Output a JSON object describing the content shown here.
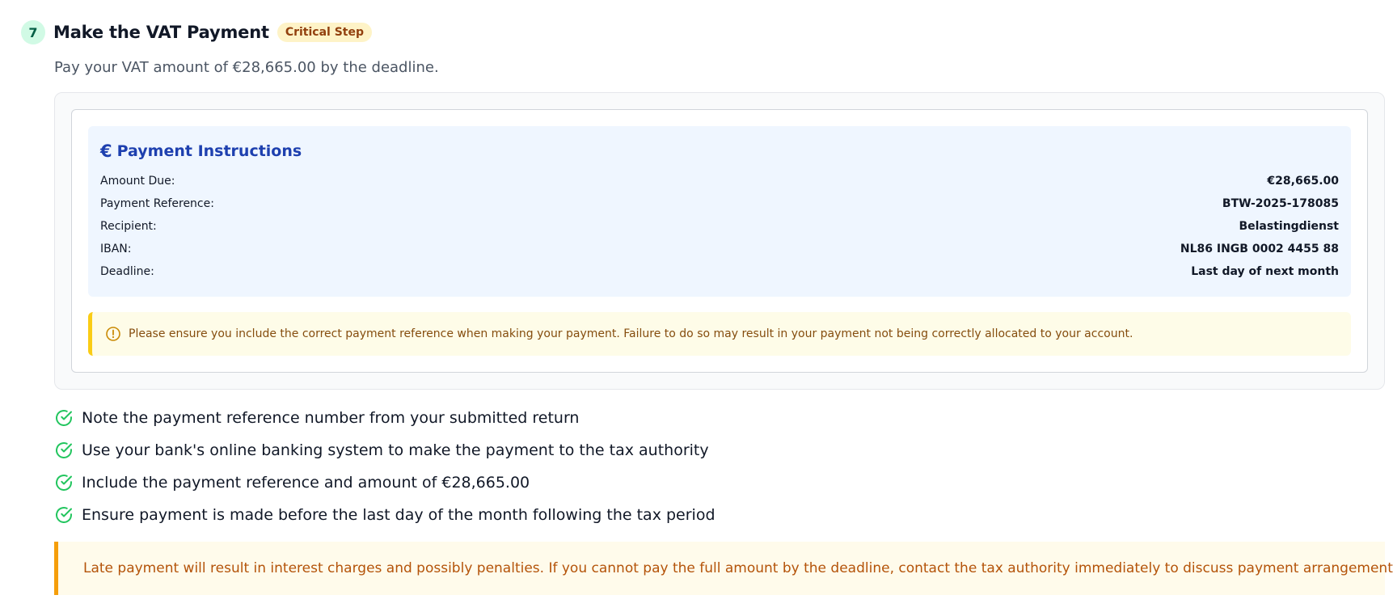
{
  "step": {
    "number": "7",
    "title": "Make the VAT Payment",
    "badge": "Critical Step",
    "description": "Pay your VAT amount of €28,665.00 by the deadline."
  },
  "payment": {
    "icon": "euro-icon",
    "icon_glyph": "€",
    "title": "Payment Instructions",
    "rows": [
      {
        "label": "Amount Due:",
        "value": "€28,665.00"
      },
      {
        "label": "Payment Reference:",
        "value": "BTW-2025-178085"
      },
      {
        "label": "Recipient:",
        "value": "Belastingdienst"
      },
      {
        "label": "IBAN:",
        "value": "NL86 INGB 0002 4455 88"
      },
      {
        "label": "Deadline:",
        "value": "Last day of next month"
      }
    ],
    "notice": "Please ensure you include the correct payment reference when making your payment. Failure to do so may result in your payment not being correctly allocated to your account."
  },
  "checklist": [
    "Note the payment reference number from your submitted return",
    "Use your bank's online banking system to make the payment to the tax authority",
    "Include the payment reference and amount of €28,665.00",
    "Ensure payment is made before the last day of the month following the tax period"
  ],
  "warning": "Late payment will result in interest charges and possibly penalties. If you cannot pay the full amount by the deadline, contact the tax authority immediately to discuss payment arrangements.",
  "colors": {
    "success": "#22c55e",
    "accent_blue": "#1e40af",
    "notice_yellow": "#facc15",
    "warning_amber": "#f59e0b"
  }
}
